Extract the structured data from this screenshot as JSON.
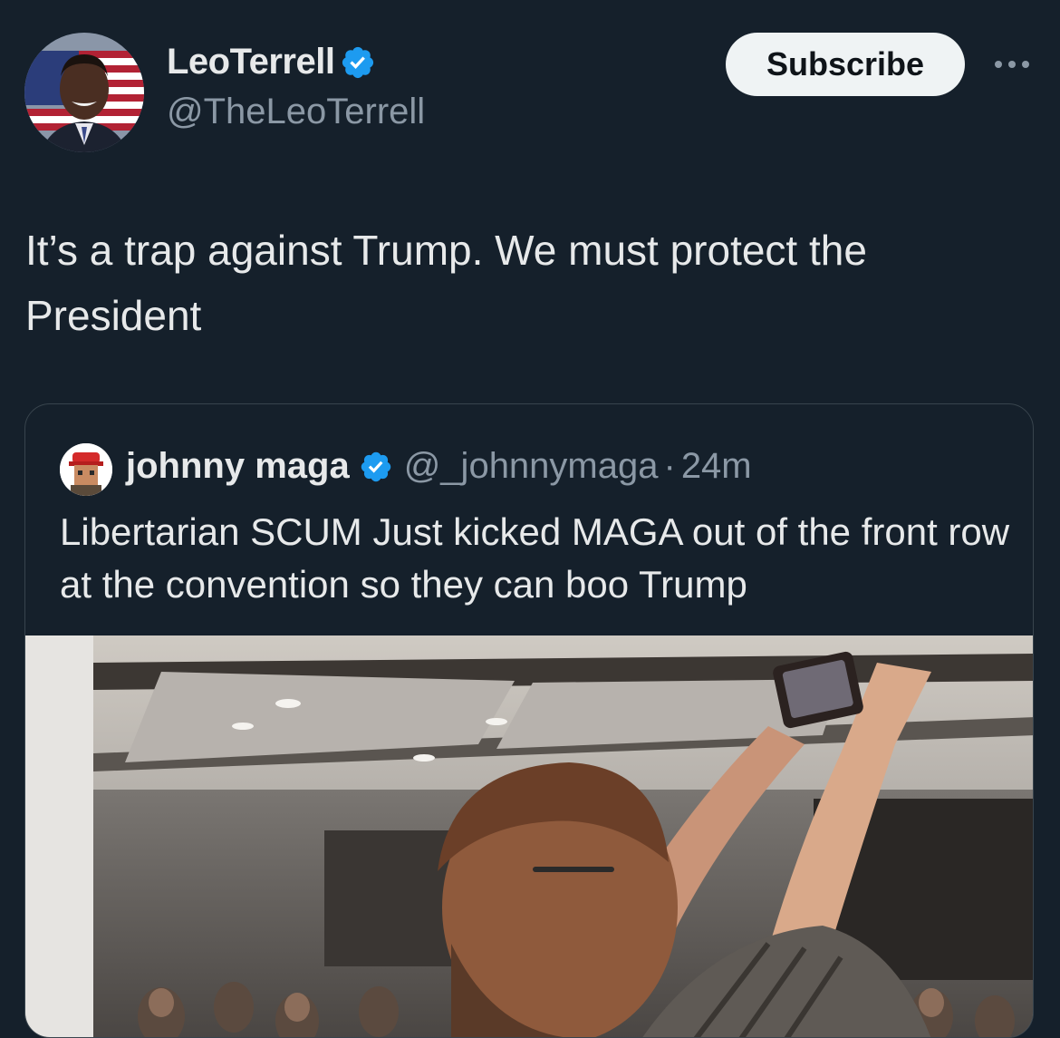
{
  "author": {
    "display_name": "LeoTerrell",
    "handle": "@TheLeoTerrell",
    "verified": true
  },
  "subscribe_label": "Subscribe",
  "more_icon": "more-horizontal-icon",
  "tweet_text": "It’s a trap against Trump. We must protect the President",
  "quoted_tweet": {
    "display_name": "johnny maga",
    "handle": "@_johnnymaga",
    "separator": "·",
    "time": "24m",
    "verified": true,
    "text": "Libertarian SCUM Just kicked MAGA out of the front row at the convention so they can boo Trump"
  },
  "colors": {
    "background": "#15202b",
    "text_primary": "#e7e9ea",
    "text_secondary": "#8b98a5",
    "verified_blue": "#1d9bf0",
    "button_bg": "#eff3f4"
  }
}
